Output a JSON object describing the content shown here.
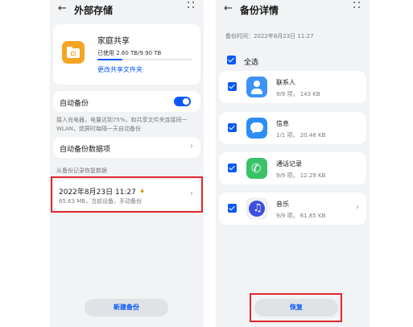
{
  "left_screen": {
    "title": "外部存储",
    "back_icon": "←",
    "family_share": {
      "icon": "folder-share-icon",
      "title": "家庭共享",
      "usage": "已使用 2.60 TB/9.90 TB",
      "usage_fraction": 0.263,
      "link": "更改共享文件夹"
    },
    "auto_backup": {
      "label": "自动备份",
      "enabled": true
    },
    "auto_backup_desc": "接入充电器，电量达到75%，和共享文件夹连接同一 WLAN，熄屏时每隔一天自动备份",
    "auto_backup_items": {
      "label": "自动备份数据项",
      "chevron": "›"
    },
    "restore_section": "从备份记录恢复数据",
    "record": {
      "title": "2022年8月23日 11:27",
      "lock_icon": "🔒",
      "meta": "65.63 MB，当前设备，手动备份",
      "chevron": "›"
    },
    "new_backup_button": "新建备份"
  },
  "right_screen": {
    "title": "备份详情",
    "back_icon": "←",
    "backup_time": "备份时间：2022年8月23日 11:27",
    "select_all": "全选",
    "items": [
      {
        "name": "联系人",
        "meta": "9/9 项，  143 KB",
        "icon": "contacts-icon",
        "chevron": ""
      },
      {
        "name": "信息",
        "meta": "1/1 项，  20.48 KB",
        "icon": "messages-icon",
        "chevron": ""
      },
      {
        "name": "通话记录",
        "meta": "9/9 项，  12.29 KB",
        "icon": "call-log-icon",
        "chevron": ""
      },
      {
        "name": "音乐",
        "meta": "9/9 项，  61.85 KB",
        "icon": "music-icon",
        "chevron": "›"
      }
    ],
    "restore_button": "恢复"
  },
  "colors": {
    "accent": "#0a59f7",
    "highlight": "#e0282e",
    "folder": "#f5a524",
    "background": "#f1f3f5"
  }
}
